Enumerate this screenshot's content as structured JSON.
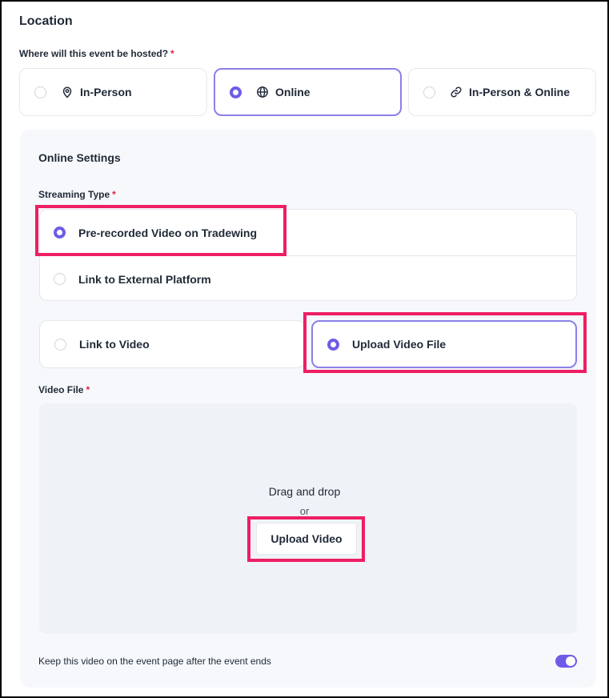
{
  "location": {
    "title": "Location",
    "hosted_question": "Where will this event be hosted?",
    "required_mark": "*",
    "options": [
      {
        "label": "In-Person",
        "icon": "map-pin-icon",
        "selected": false
      },
      {
        "label": "Online",
        "icon": "globe-icon",
        "selected": true
      },
      {
        "label": "In-Person & Online",
        "icon": "link-icon",
        "selected": false
      }
    ]
  },
  "online_settings": {
    "title": "Online Settings",
    "streaming_type_label": "Streaming Type",
    "streaming_types": [
      {
        "label": "Pre-recorded Video on Tradewing",
        "selected": true
      },
      {
        "label": "Link to External Platform",
        "selected": false
      }
    ],
    "video_sources": [
      {
        "label": "Link to Video",
        "selected": false
      },
      {
        "label": "Upload Video File",
        "selected": true
      }
    ],
    "video_file_label": "Video File",
    "dropzone": {
      "drag_text": "Drag and drop",
      "or_text": "or",
      "upload_button": "Upload Video"
    },
    "keep_video_label": "Keep this video on the event page after the event ends",
    "keep_video_enabled": true
  },
  "colors": {
    "accent": "#6d5ce8",
    "selected_border": "#8b80e8",
    "required": "#e11d48",
    "highlight": "#ee1e63",
    "panel_bg": "#f6f8fb"
  }
}
